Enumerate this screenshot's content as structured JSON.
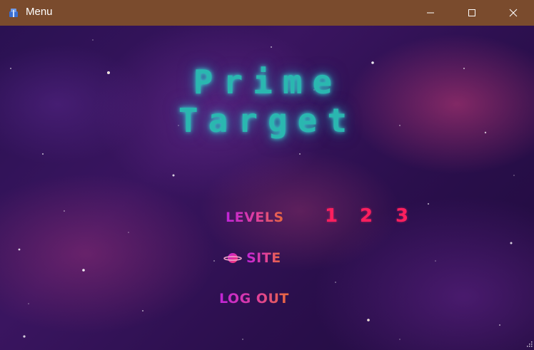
{
  "window": {
    "title": "Menu",
    "titlebar_color": "#7a4b2d",
    "icons": {
      "app": "app-icon",
      "minimize": "minimize-icon",
      "maximize": "maximize-icon",
      "close": "close-icon"
    }
  },
  "game": {
    "title_line1": "Prime",
    "title_line2": "Target",
    "title_color": "#2ab7b0"
  },
  "menu": {
    "levels_label": "LEVELS",
    "levels": [
      "1",
      "2",
      "3"
    ],
    "site_label": "SITE",
    "site_icon": "planet-icon",
    "logout_label": "LOG OUT",
    "accent_colors": [
      "#c024d9",
      "#e0409a",
      "#e86a3a"
    ],
    "level_color": "#ff1f5e"
  }
}
